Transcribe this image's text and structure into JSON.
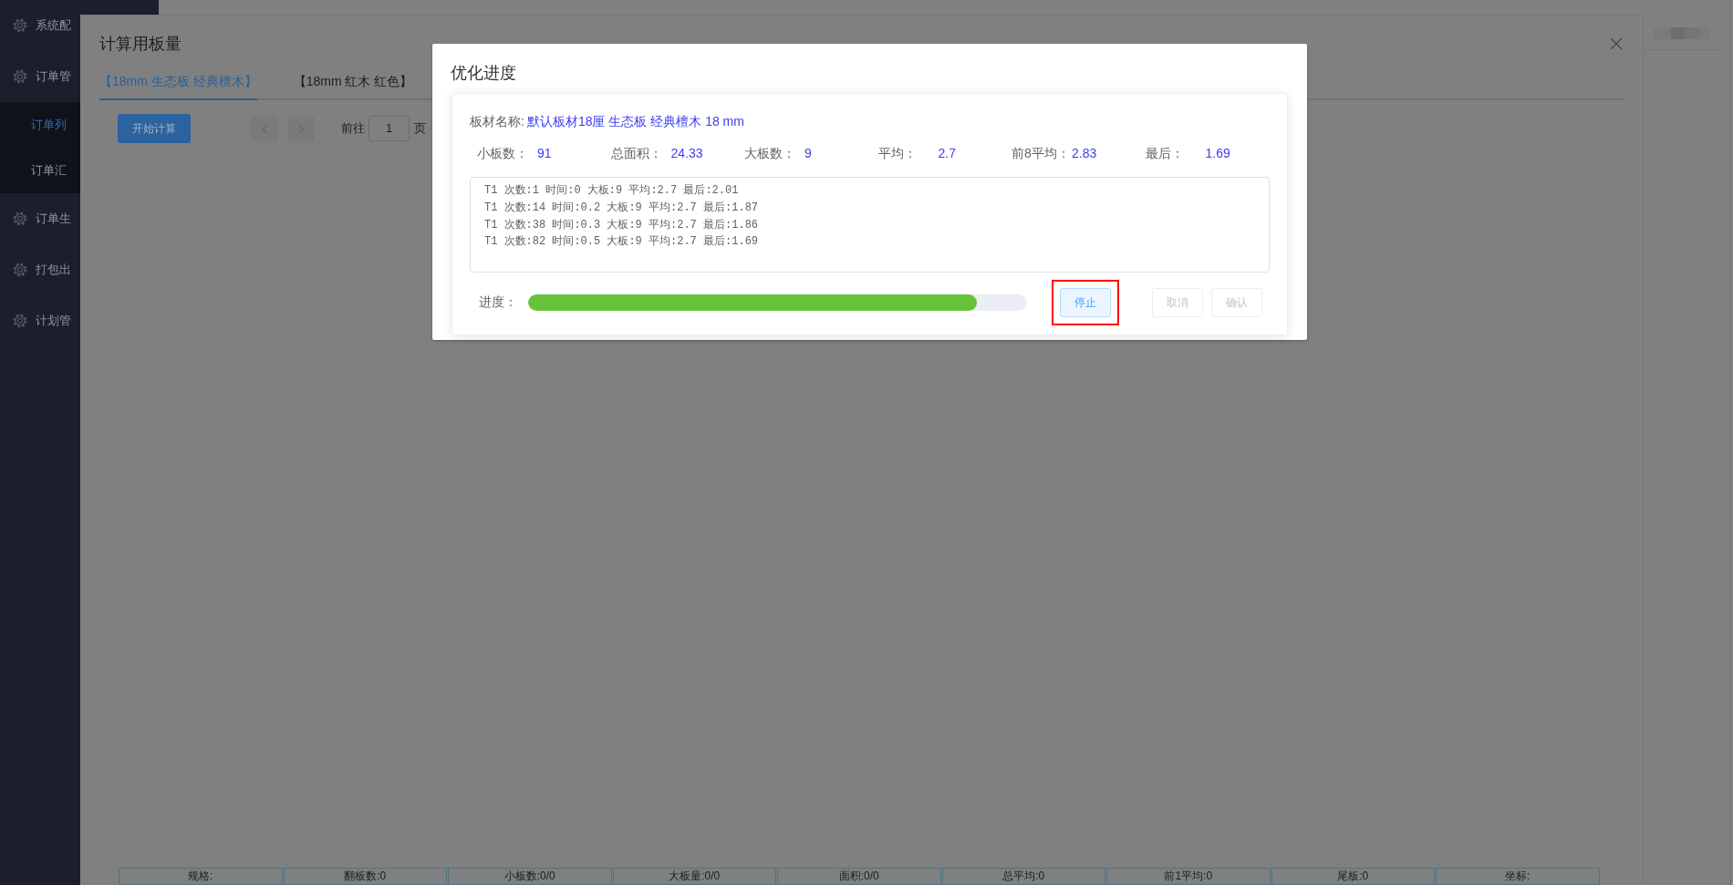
{
  "sidebar": {
    "items": [
      {
        "label": "系统配",
        "selected": false
      },
      {
        "label": "订单管",
        "selected": false,
        "children": [
          {
            "label": "订单列",
            "selected": true
          },
          {
            "label": "订单汇",
            "selected": false
          }
        ]
      },
      {
        "label": "订单生",
        "selected": false
      },
      {
        "label": "打包出",
        "selected": false
      },
      {
        "label": "计划管",
        "selected": false
      }
    ]
  },
  "calc_dialog": {
    "title": "计算用板量",
    "tabs": [
      {
        "label": "【18mm 生态板 经典檀木】",
        "selected": true
      },
      {
        "label": "【18mm 红木 红色】",
        "selected": false
      }
    ],
    "start_button": "开始计算",
    "pagination": {
      "goto_label": "前往",
      "page_input": "1",
      "page_suffix": "页"
    },
    "summary_row": [
      "规格:",
      "翻板数:0",
      "小板数:0/0",
      "大板量:0/0",
      "面积:0/0",
      "总平均:0",
      "前1平均:0",
      "尾板:0",
      "坐标:"
    ]
  },
  "progress_dialog": {
    "title": "优化进度",
    "board_name_label": "板材名称:",
    "board_name": "默认板材18厘 生态板 经典檀木 18 mm",
    "stats": [
      {
        "label": "小板数：",
        "value": "91"
      },
      {
        "label": "总面积：",
        "value": "24.33"
      },
      {
        "label": "大板数：",
        "value": "9"
      },
      {
        "label": "平均：",
        "value": "2.7"
      },
      {
        "label": "前8平均：",
        "value": "2.83"
      },
      {
        "label": "最后：",
        "value": "1.69"
      }
    ],
    "log": [
      "T1 次数:1 时间:0 大板:9 平均:2.7 最后:2.01",
      "T1 次数:14 时间:0.2 大板:9 平均:2.7 最后:1.87",
      "T1 次数:38 时间:0.3 大板:9 平均:2.7 最后:1.86",
      "T1 次数:82 时间:0.5 大板:9 平均:2.7 最后:1.69"
    ],
    "progress_label": "进度：",
    "progress": {
      "level": 0.9
    },
    "buttons": [
      {
        "label": "停止",
        "disabled": false,
        "highlighted": true
      },
      {
        "label": "取消",
        "disabled": true,
        "highlighted": false
      },
      {
        "label": "确认",
        "disabled": true,
        "highlighted": false
      }
    ]
  }
}
